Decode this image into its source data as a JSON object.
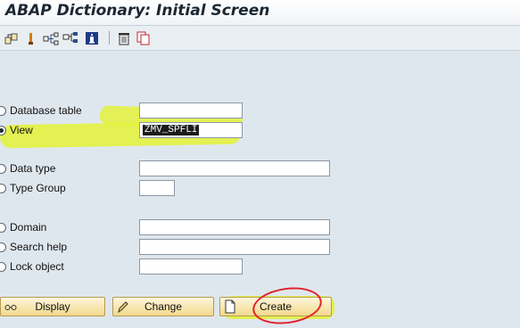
{
  "window": {
    "title": "ABAP Dictionary: Initial Screen"
  },
  "toolbar": {
    "icons": [
      "other-object-icon",
      "active-inactive-icon",
      "where-used-icon",
      "hierarchy-icon",
      "info-icon",
      "delete-icon",
      "copy-icon"
    ]
  },
  "form": {
    "database_table": {
      "label": "Database table",
      "value": "",
      "selected": false
    },
    "view": {
      "label": "View",
      "value": "ZMV_SPFLI",
      "selected": true
    },
    "data_type": {
      "label": "Data type",
      "value": "",
      "selected": false
    },
    "type_group": {
      "label": "Type Group",
      "value": "",
      "selected": false
    },
    "domain": {
      "label": "Domain",
      "value": "",
      "selected": false
    },
    "search_help": {
      "label": "Search help",
      "value": "",
      "selected": false
    },
    "lock_object": {
      "label": "Lock object",
      "value": "",
      "selected": false
    }
  },
  "buttons": {
    "display": "Display",
    "change": "Change",
    "create": "Create"
  },
  "annotations": {
    "highlight_color": "#e4f23c",
    "circle_color": "#e2212d"
  }
}
